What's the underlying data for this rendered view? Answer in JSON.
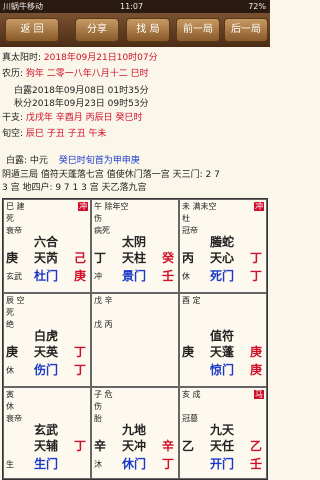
{
  "status_bar": {
    "carrier": "川蜗牛移动",
    "time": "11:07",
    "battery": "72%"
  },
  "toolbar": {
    "back": "返 回",
    "share": "分享",
    "find": "找 局",
    "prev": "前一局",
    "next": "后一局"
  },
  "info": {
    "true_solar_label": "真太阳时:",
    "true_solar_value": "2018年09月21日10时07分",
    "lunar_label": "农历:",
    "lunar_value": "狗年 二零一八年八月十二 巳时",
    "bailu": "白露2018年09月08日 01时35分",
    "qiufen": "秋分2018年09月23日 09时53分",
    "ganzhi_label": "干支:",
    "ganzhi_value": "戊戌年 辛酉月 丙辰日 癸巳时",
    "xunkong_label": "旬空:",
    "xunkong_value": "辰巳  子丑  子丑  午未",
    "yuan_label": "白露: 中元",
    "yuan_extra": "癸巳时旬首为甲申庚",
    "ju_line": "阴遁三局  值符天蓬落七宫 值使休门落一宫 天三门: 2 7",
    "ju_line2": "3 宫  地四户: 9 7 1 3 宫 天乙落九宫"
  },
  "palaces": [
    {
      "name": "巽四",
      "l1": "巳 建",
      "kong": "冲",
      "l2": "死",
      "l3": "衰帝",
      "l4": "甲 庚",
      "shen": "六合",
      "l5": "庚",
      "star": "天芮",
      "gan": "己",
      "gan2": "丁",
      "l6": "玄武",
      "door": "杜门",
      "gan3": "庚"
    },
    {
      "name": "离九",
      "l1": "午 除年空",
      "kong": "",
      "l2": "伤",
      "l3": "病死",
      "l4": "乙 丁",
      "shen": "太阴",
      "l5": "丁",
      "star": "天柱",
      "gan": "癸",
      "gan2": "",
      "l6": "冲",
      "door": "景门",
      "gan3": "壬"
    },
    {
      "name": "坤二",
      "l1": "未 满未空",
      "kong": "冲",
      "l2": "杜",
      "l3": "冠帝",
      "l4": "丙 壬",
      "shen": "螣蛇",
      "l5": "丙",
      "star": "天心",
      "gan": "丁",
      "gan2": "",
      "l6": "休",
      "door": "死门",
      "gan3": "丁"
    },
    {
      "name": "震三",
      "l1": "辰 空",
      "kong": "",
      "l2": "死",
      "l3": "绝",
      "l4": "",
      "shen": "白虎",
      "l5": "庚",
      "star": "天英",
      "gan": "丁",
      "gan2": "",
      "l6": "休",
      "door": "伤门",
      "gan3": "丁"
    },
    {
      "name": "中五",
      "l1": "戊 辛",
      "kong": "",
      "l2": "",
      "l3": "戊 丙",
      "l4": "",
      "shen": "",
      "l5": "",
      "star": "",
      "gan": "",
      "gan2": "",
      "l6": "",
      "door": "",
      "gan3": ""
    },
    {
      "name": "兑七",
      "l1": "酉 定",
      "kong": "",
      "l2": "",
      "l3": "",
      "l4": "",
      "shen": "值符",
      "l5": "庚",
      "star": "天蓬",
      "gan": "庚",
      "gan2": "",
      "l6": "",
      "door": "惊门",
      "gan3": "庚"
    },
    {
      "name": "艮八",
      "l1": "寅",
      "kong": "",
      "l2": "休",
      "l3": "衰帝",
      "l4": "壬",
      "shen": "玄武",
      "l5": "",
      "star": "天辅",
      "gan": "丁",
      "gan2": "",
      "l6": "生",
      "door": "生门",
      "gan3": ""
    },
    {
      "name": "坎一",
      "l1": "子 危",
      "kong": "",
      "l2": "伤",
      "l3": "胎",
      "l4": "癸 甲",
      "shen": "九地",
      "l5": "辛",
      "star": "天冲",
      "gan": "辛",
      "gan2": "",
      "l6": "沐",
      "door": "休门",
      "gan3": "丁"
    },
    {
      "name": "乾六",
      "l1": "亥 成",
      "kong": "马",
      "l2": "",
      "l3": "冠墓",
      "l4": "壬 丁",
      "shen": "九天",
      "l5": "乙",
      "star": "天任",
      "gan": "乙",
      "gan2": "",
      "l6": "",
      "door": "开门",
      "gan3": "壬"
    }
  ]
}
